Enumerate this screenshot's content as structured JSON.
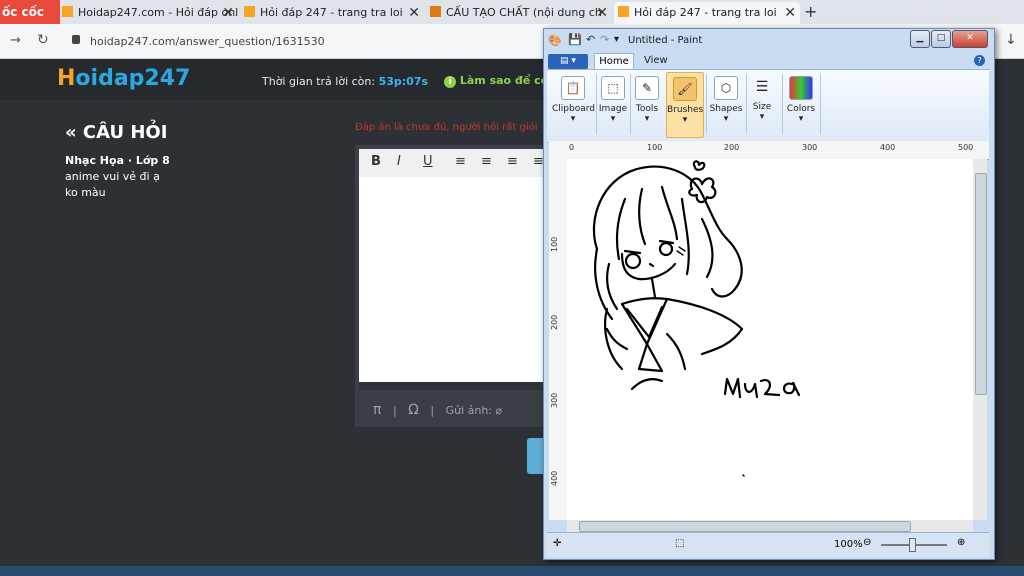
{
  "browser": {
    "brand": "ốc cốc",
    "tabs": [
      {
        "label": "Hoidap247.com - Hỏi đáp onl"
      },
      {
        "label": "Hỏi đáp 247 - trang tra loi"
      },
      {
        "label": "CẤU TẠO CHẤT (nội dung ch"
      },
      {
        "label": "Hỏi đáp 247 - trang tra loi"
      }
    ],
    "new_tab": "+",
    "url": "hoidap247.com/answer_question/1631530",
    "download_icon": "↓"
  },
  "site": {
    "logo": "Hoidap247",
    "timer_label": "Thời gian trả lời còn:",
    "timer_value": "53p:07s",
    "help_label": "Làm sao để có",
    "question_heading": "« CÂU HỎI",
    "subject": "Nhạc Họa · Lớp 8",
    "question_line1": "anime vui vẻ đi ạ",
    "question_line2": "ko màu",
    "warning": "Đáp án là chưa đủ, người hỏi rất giỏi",
    "editor_tools": [
      "B",
      "I",
      "U",
      "≡",
      "≡",
      "≡",
      "≡"
    ],
    "extras_pi": "π",
    "extras_omega": "Ω",
    "send_image": "Gửi ảnh:"
  },
  "paint": {
    "title": "Untitled - Paint",
    "file_menu": "▤ ▾",
    "tab_home": "Home",
    "tab_view": "View",
    "groups": [
      "Clipboard",
      "Image",
      "Tools",
      "Brushes",
      "Shapes",
      "Size",
      "Colors"
    ],
    "ruler_h": [
      "0",
      "100",
      "200",
      "300",
      "400",
      "500"
    ],
    "ruler_v": [
      "100",
      "200",
      "300",
      "400"
    ],
    "zoom": "100%",
    "signature": "Mưa"
  }
}
